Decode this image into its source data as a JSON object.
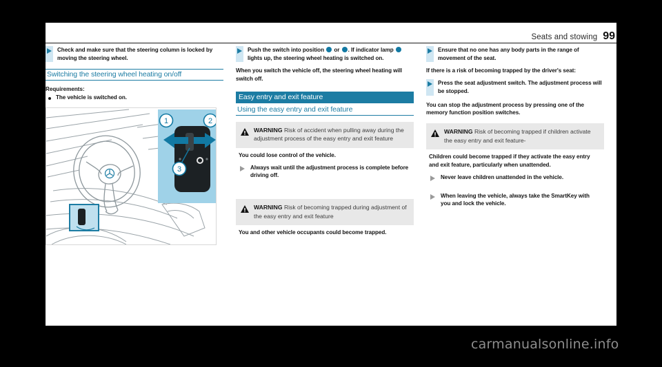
{
  "header": {
    "title": "Seats and stowing",
    "page_number": "99"
  },
  "watermark": "carmanualsonline.info",
  "colors": {
    "accent_teal": "#1c7ca3",
    "bullet_bar": "#cfe6f2",
    "warning_bg": "#e8e8e8",
    "indicator_blue": "#1279a3"
  },
  "column1": {
    "bullet1": "Check and make sure that the steering column is locked by moving the steering wheel.",
    "section_heading": "Switching the steering wheel heating on/off",
    "requirements_label": "Requirements:",
    "requirement1": "The vehicle is switched on.",
    "figure": {
      "caption_numbers": [
        "1",
        "2",
        "3"
      ],
      "alt": "Steering wheel and steering column adjustment switch"
    }
  },
  "column2": {
    "bullet1_part1": "Push the switch into position",
    "bullet1_part2": "or",
    "bullet1_part3": ".",
    "bullet1_line2_part1": "If indicator lamp",
    "bullet1_line2_part2": "lights up, the steering wheel heating is switched on.",
    "para1": "When you switch the vehicle off, the steering wheel heating will switch off.",
    "banner": "Easy entry and exit feature",
    "subhead": "Using the easy entry and exit feature",
    "warning1": {
      "label": "WARNING",
      "title": "Risk of accident when pulling away during the adjustment process of the easy entry and exit feature",
      "body": "You could lose control of the vehicle.",
      "action": "Always wait until the adjustment process is complete before driving off."
    },
    "warning2": {
      "label": "WARNING",
      "title": "Risk of becoming trapped during adjustment of the easy entry and exit feature",
      "body": "You and other vehicle occupants could become trapped."
    }
  },
  "column3": {
    "bullet1": "Ensure that no one has any body parts in the range of movement of the seat.",
    "para1": "If there is a risk of becoming trapped by the driver's seat:",
    "bullet2": "Press the seat adjustment switch. The adjustment process will be stopped.",
    "para2": "You can stop the adjustment process by pressing one of the memory function position switches.",
    "warning3": {
      "label": "WARNING",
      "title": "Risk of becoming trapped if children activate the easy entry and exit feature-",
      "body": "Children could become trapped if they activate the easy entry and exit feature, particularly when unattended.",
      "action1": "Never leave children unattended in the vehicle.",
      "action2": "When leaving the vehicle, always take the SmartKey with you and lock the vehicle."
    }
  }
}
